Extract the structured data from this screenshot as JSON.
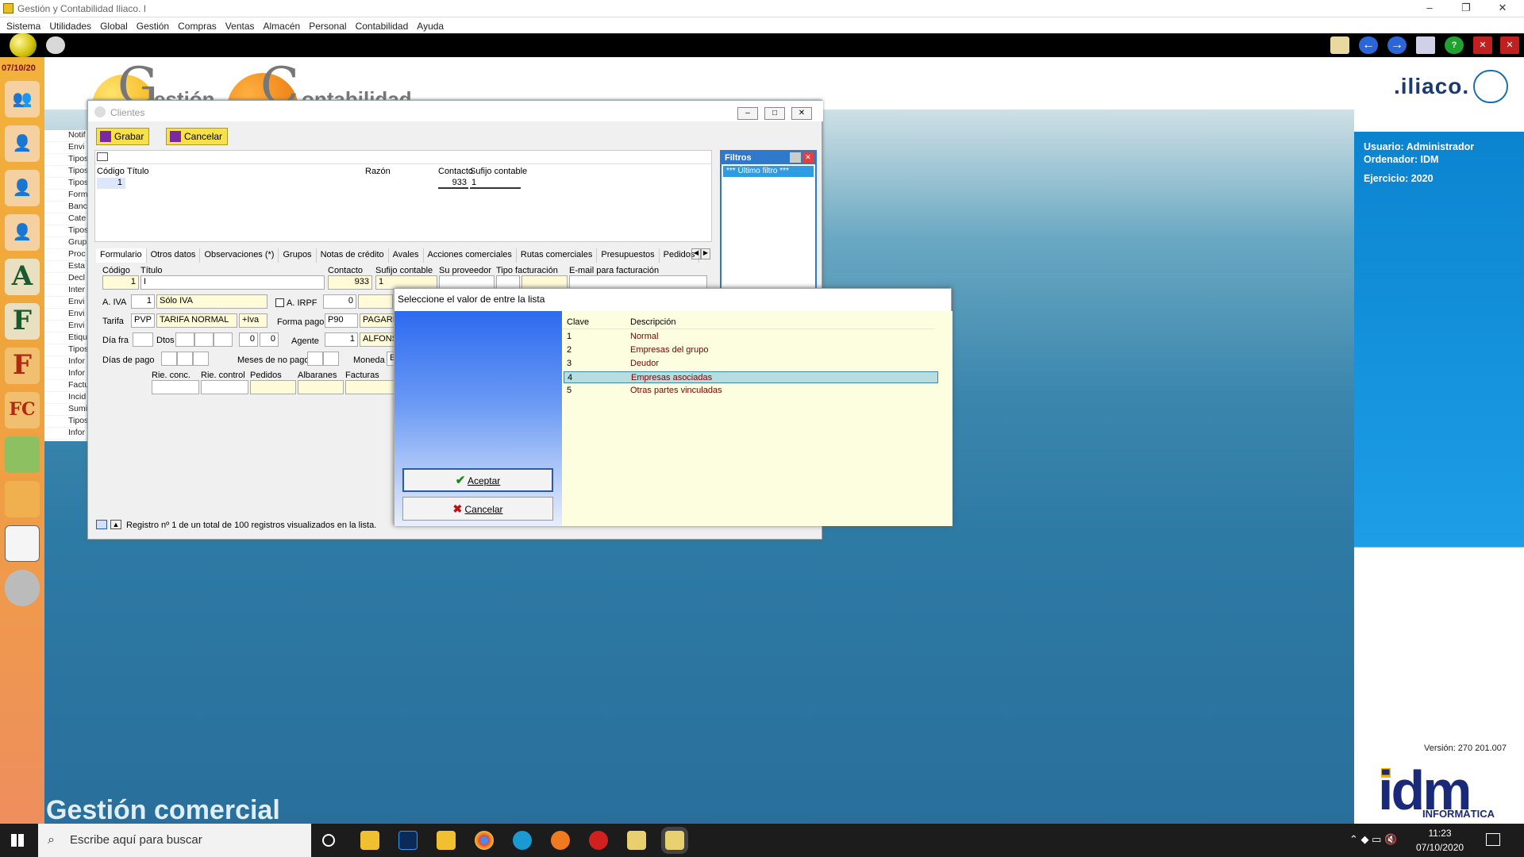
{
  "window": {
    "title": "Gestión y Contabilidad Iliaco. I"
  },
  "menu": [
    "Sistema",
    "Utilidades",
    "Global",
    "Gestión",
    "Compras",
    "Ventas",
    "Almacén",
    "Personal",
    "Contabilidad",
    "Ayuda"
  ],
  "leftbar": {
    "date": "07/10/20"
  },
  "header": {
    "gestion_letter": "G",
    "gestion_text": "estión",
    "conta_letter": "C",
    "conta_text": "ontabilidad",
    "logo": ".iliaco."
  },
  "navlist": [
    "Notif",
    "Envi",
    "Tipos",
    "Tipos",
    "Tipos",
    "Form",
    "Banc",
    "Cate",
    "Tipos",
    "Grup",
    "Proc",
    "Esta",
    "Decl",
    "Inter",
    "Envi",
    "Envi",
    "Envi",
    "Etiqu",
    "Tipos",
    "Infor",
    "Infor",
    "Factu",
    "Incid",
    "Sumi",
    "Tipos",
    "Infor"
  ],
  "userinfo": {
    "usuario": "Usuario: Administrador",
    "ordenador": "Ordenador: IDM",
    "ejercicio": "Ejercicio: 2020",
    "version": "Versión: 270 201.007"
  },
  "brand": {
    "idm": "idm",
    "idm_sub": "INFORMÁTICA",
    "footer": "Gestión comercial"
  },
  "clientes": {
    "title": "Clientes",
    "grabar": "Grabar",
    "cancelar": "Cancelar",
    "grid_headers": {
      "codigo": "Código",
      "titulo": "Título",
      "razon": "Razón",
      "contacto": "Contacto",
      "sufijo": "Sufijo contable"
    },
    "grid_row": {
      "codigo": "1",
      "contacto": "933",
      "sufijo": "1"
    },
    "filtros": {
      "title": "Filtros",
      "item": "*** Último filtro ***"
    },
    "tabs": [
      "Formulario",
      "Otros datos",
      "Observaciones (*)",
      "Grupos",
      "Notas de crédito",
      "Avales",
      "Acciones comerciales",
      "Rutas comerciales",
      "Presupuestos",
      "Pedidos"
    ],
    "form": {
      "codigo_lbl": "Código",
      "titulo_lbl": "Título",
      "contacto_lbl": "Contacto",
      "sufijo_lbl": "Sufijo contable",
      "proveedor_lbl": "Su proveedor",
      "tipofact_lbl": "Tipo facturación",
      "email_lbl": "E-mail para facturación",
      "codigo": "1",
      "titulo": "I",
      "contacto": "933",
      "sufijo": "1",
      "aiva_lbl": "A. IVA",
      "aiva": "1",
      "aiva_desc": "Sólo IVA",
      "airpf_lbl": "A. IRPF",
      "airpf": "0",
      "tarifa_lbl": "Tarifa",
      "tarifa": "PVP",
      "tarifa_desc": "TARIFA NORMAL",
      "tarifa_iva": "+Iva",
      "formapago_lbl": "Forma pago",
      "formapago": "P90",
      "formapago_desc": "PAGARE",
      "diafra_lbl": "Día fra",
      "dtos_lbl": "Dtos",
      "dto1": "0",
      "dto2": "0",
      "agente_lbl": "Agente",
      "agente": "1",
      "agente_desc": "ALFONS",
      "diaspago_lbl": "Días de pago",
      "mesesnopago_lbl": "Meses de no pago",
      "moneda_lbl": "Moneda",
      "moneda": "E",
      "rie_conc": "Rie. conc.",
      "rie_control": "Rie. control",
      "pedidos": "Pedidos",
      "albaranes": "Albaranes",
      "facturas": "Facturas"
    },
    "status": "Registro nº 1 de un total de 100 registros visualizados en la lista."
  },
  "dialog": {
    "title": "Seleccione el valor de entre la lista",
    "col_clave": "Clave",
    "col_desc": "Descripción",
    "rows": [
      {
        "k": "1",
        "v": "Normal"
      },
      {
        "k": "2",
        "v": "Empresas del grupo"
      },
      {
        "k": "3",
        "v": "Deudor"
      },
      {
        "k": "4",
        "v": "Empresas asociadas"
      },
      {
        "k": "5",
        "v": "Otras partes vinculadas"
      }
    ],
    "selected_row": 4,
    "aceptar": "Aceptar",
    "cancelar": "Cancelar"
  },
  "taskbar": {
    "search": "Escribe aquí para buscar",
    "time": "11:23",
    "date": "07/10/2020"
  }
}
